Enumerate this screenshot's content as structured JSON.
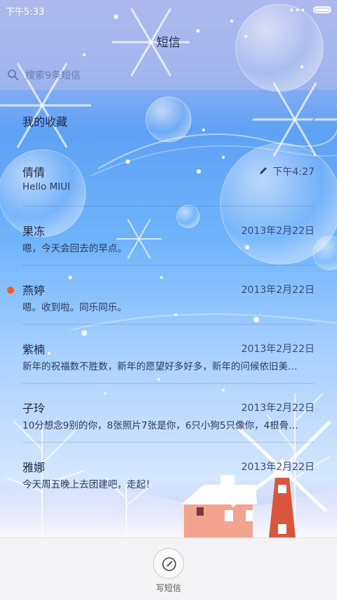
{
  "status_bar": {
    "time": "下午5:33",
    "signal_dots": "•••"
  },
  "header": {
    "title": "短信"
  },
  "search": {
    "placeholder": "搜索9条短信"
  },
  "favorites": {
    "label": "我的收藏"
  },
  "conversations": [
    {
      "name": "倩倩",
      "preview": "Hello MIUI",
      "date": "下午4:27",
      "unread": false,
      "draft_pencil": true
    },
    {
      "name": "果冻",
      "preview": "嗯，今天会回去的早点。",
      "date": "2013年2月22日",
      "unread": false
    },
    {
      "name": "燕婷",
      "preview": "嗯。收到啦。同乐同乐。",
      "date": "2013年2月22日",
      "unread": true
    },
    {
      "name": "紫楠",
      "preview": "新年的祝福数不胜数，新年的愿望好多好多，新年的问候依旧美…",
      "date": "2013年2月22日",
      "unread": false
    },
    {
      "name": "子玲",
      "preview": "10分想念9别的你，8张照片7张是你，6只小狗5只像你，4根骨…",
      "date": "2013年2月22日",
      "unread": false
    },
    {
      "name": "雅娜",
      "preview": "今天周五晚上去团建吧，走起！",
      "date": "2013年2月22日",
      "unread": false
    }
  ],
  "bottom_bar": {
    "compose_label": "写短信"
  },
  "colors": {
    "unread_dot": "#ff5a1f",
    "text_primary": "#1f2a44",
    "bottom_bg": "#f4f4f6"
  }
}
